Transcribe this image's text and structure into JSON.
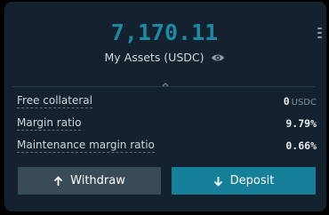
{
  "balance": {
    "amount": "7,170.11",
    "color": "#1c8aa3"
  },
  "assets": {
    "label": "My Assets (USDC)",
    "toggle_icon": "eye-icon"
  },
  "stats": [
    {
      "label": "Free collateral",
      "value": "0",
      "unit": "USDC"
    },
    {
      "label": "Margin ratio",
      "value": "9.79%",
      "unit": ""
    },
    {
      "label": "Maintenance margin ratio",
      "value": "0.66%",
      "unit": ""
    }
  ],
  "actions": {
    "withdraw_label": "Withdraw",
    "withdraw_icon": "arrow-up-icon",
    "deposit_label": "Deposit",
    "deposit_icon": "arrow-down-icon",
    "deposit_color": "#16809a",
    "withdraw_color": "#3a4b58"
  }
}
